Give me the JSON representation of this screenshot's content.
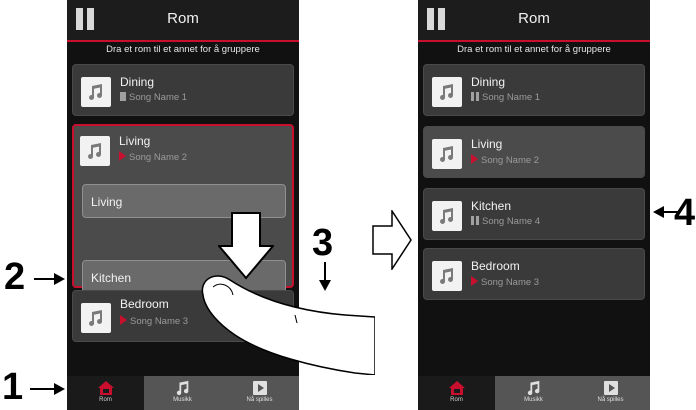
{
  "screens": [
    {
      "title": "Rom",
      "hint": "Dra et rom til et annet for å gruppere",
      "cards": [
        {
          "room": "Dining",
          "song": "Song Name 1"
        },
        {
          "room": "Living",
          "song": "Song Name 2"
        },
        {
          "room": "Bedroom",
          "song": "Song Name 3"
        }
      ],
      "group_items": [
        "Living",
        "Kitchen"
      ],
      "tabs": [
        "Rom",
        "Musikk",
        "Nå spilles"
      ]
    },
    {
      "title": "Rom",
      "hint": "Dra et rom til et annet for å gruppere",
      "cards": [
        {
          "room": "Dining",
          "song": "Song Name 1"
        },
        {
          "room": "Living",
          "song": "Song Name 2"
        },
        {
          "room": "Kitchen",
          "song": "Song Name 4"
        },
        {
          "room": "Bedroom",
          "song": "Song Name 3"
        }
      ],
      "tabs": [
        "Rom",
        "Musikk",
        "Nå spilles"
      ]
    }
  ],
  "callouts": [
    "1",
    "2",
    "3",
    "4"
  ],
  "colors": {
    "accent": "#c8102e",
    "background": "#111111"
  }
}
